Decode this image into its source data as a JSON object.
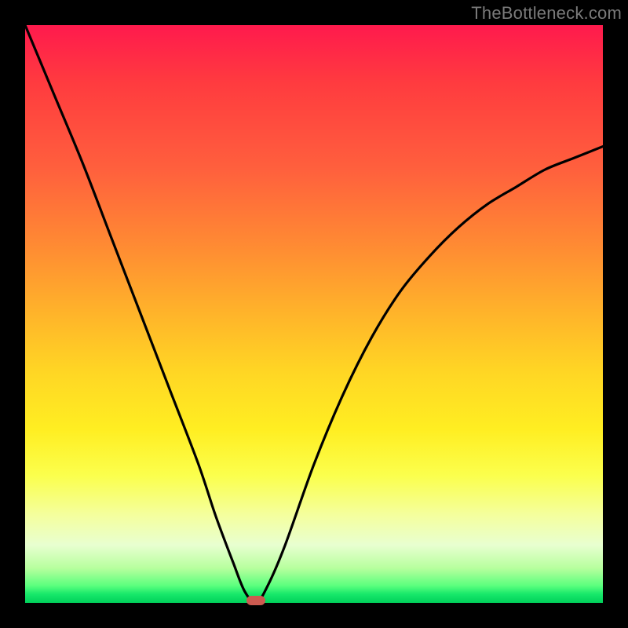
{
  "watermark": "TheBottleneck.com",
  "colors": {
    "curve": "#000000",
    "marker": "#cc5a50",
    "frame": "#000000"
  },
  "chart_data": {
    "type": "line",
    "title": "",
    "xlabel": "",
    "ylabel": "",
    "xlim": [
      0,
      100
    ],
    "ylim": [
      0,
      100
    ],
    "grid": false,
    "legend": false,
    "annotations": [
      {
        "text": "TheBottleneck.com",
        "pos": "top-right"
      }
    ],
    "series": [
      {
        "name": "bottleneck-curve",
        "comment": "Approximate values read from the V-shaped curve. y=0 at the minimum near x≈40; rises steeply on both sides toward 100.",
        "x": [
          0,
          5,
          10,
          15,
          20,
          25,
          30,
          33,
          36,
          38,
          40,
          42,
          45,
          50,
          55,
          60,
          65,
          70,
          75,
          80,
          85,
          90,
          95,
          100
        ],
        "values": [
          100,
          88,
          76,
          63,
          50,
          37,
          24,
          15,
          7,
          2,
          0,
          3,
          10,
          24,
          36,
          46,
          54,
          60,
          65,
          69,
          72,
          75,
          77,
          79
        ]
      }
    ],
    "minimum": {
      "x": 40,
      "y": 0
    }
  }
}
